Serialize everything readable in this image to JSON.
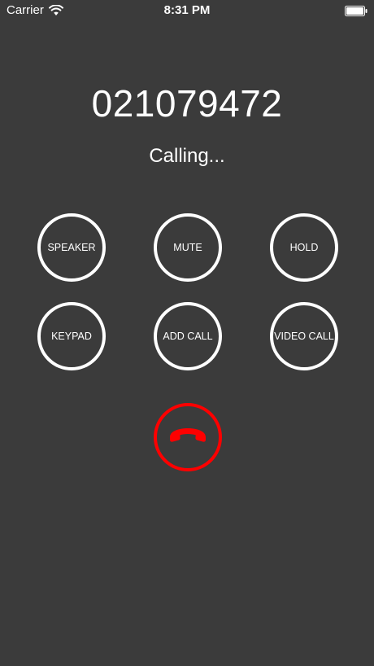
{
  "status_bar": {
    "carrier": "Carrier",
    "time": "8:31 PM",
    "wifi_icon": "wifi-icon",
    "battery_icon": "battery-icon"
  },
  "call": {
    "number": "021079472",
    "status": "Calling..."
  },
  "controls": {
    "speaker": "SPEAKER",
    "mute": "MUTE",
    "hold": "HOLD",
    "keypad": "KEYPAD",
    "add_call": "ADD CALL",
    "video_call": "VIDEO CALL"
  },
  "end_call": {
    "icon": "end-call-icon",
    "color": "#ff0000"
  },
  "colors": {
    "background": "#3b3b3b",
    "foreground": "#ffffff",
    "end_call": "#ff0000"
  }
}
